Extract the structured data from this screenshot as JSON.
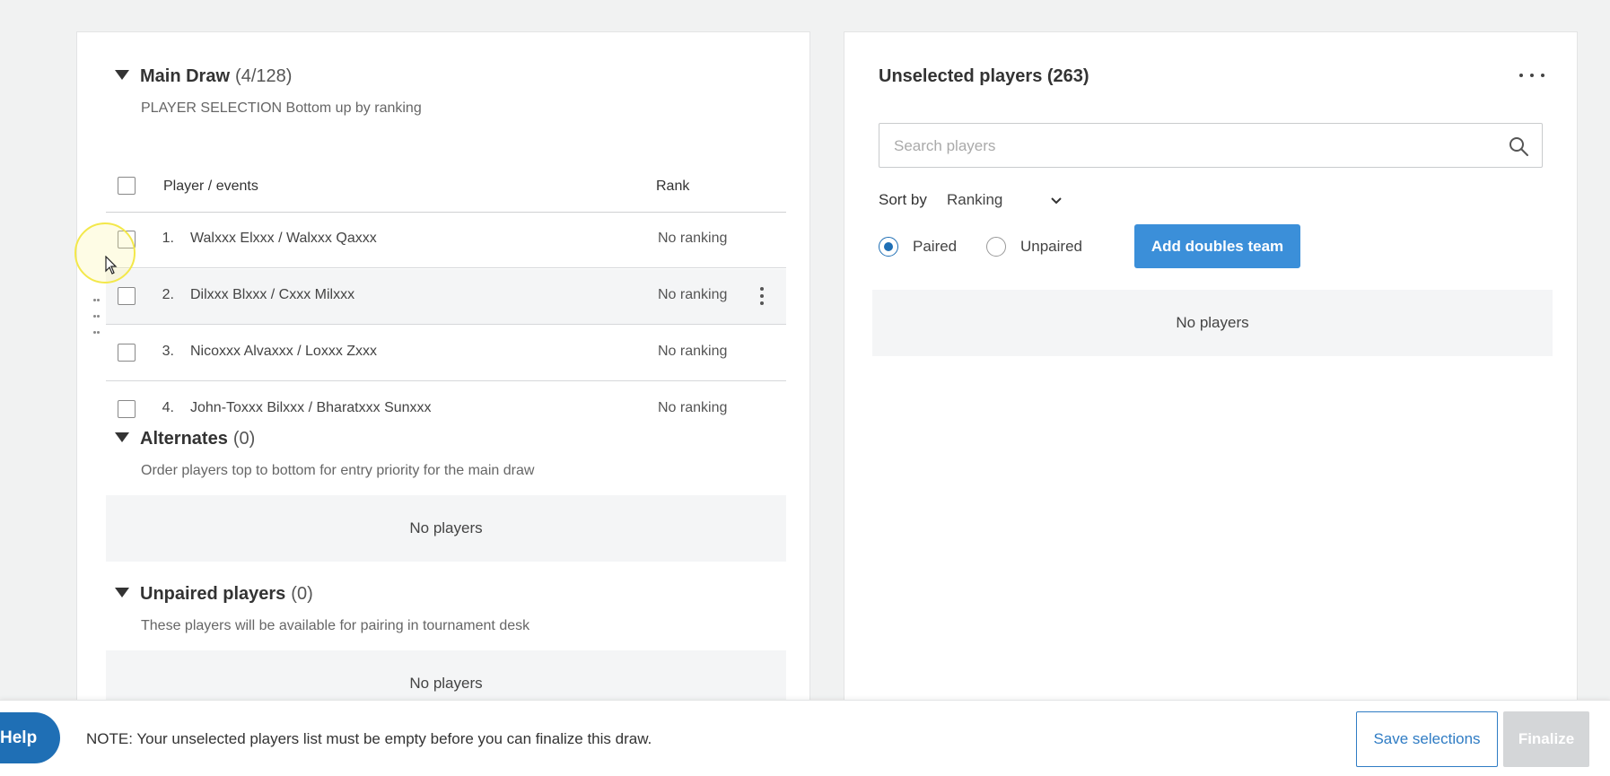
{
  "main_draw": {
    "title": "Main Draw",
    "count": "(4/128)",
    "subtitle": "PLAYER SELECTION Bottom up by ranking",
    "columns": {
      "player": "Player / events",
      "rank": "Rank"
    },
    "rows": [
      {
        "num": "1.",
        "name": "Walxxx Elxxx / Walxxx Qaxxx",
        "rank": "No ranking"
      },
      {
        "num": "2.",
        "name": "Dilxxx Blxxx / Cxxx Milxxx",
        "rank": "No ranking"
      },
      {
        "num": "3.",
        "name": "Nicoxxx Alvaxxx / Loxxx Zxxx",
        "rank": "No ranking"
      },
      {
        "num": "4.",
        "name": "John-Toxxx Bilxxx / Bharatxxx Sunxxx",
        "rank": "No ranking"
      }
    ]
  },
  "alternates": {
    "title": "Alternates",
    "count": "(0)",
    "subtitle": "Order players top to bottom for entry priority for the main draw",
    "empty": "No players"
  },
  "unpaired": {
    "title": "Unpaired players",
    "count": "(0)",
    "subtitle": "These players will be available for pairing in tournament desk",
    "empty": "No players"
  },
  "unselected": {
    "title": "Unselected players (263)",
    "search_placeholder": "Search players",
    "sort_label": "Sort by",
    "sort_value": "Ranking",
    "radio_paired": "Paired",
    "radio_unpaired": "Unpaired",
    "add_button": "Add doubles team",
    "empty": "No players"
  },
  "footer": {
    "help": "Help",
    "note": "NOTE: Your unselected players list must be empty before you can finalize this draw.",
    "save": "Save selections",
    "finalize": "Finalize"
  },
  "colors": {
    "primary": "#3b8fd9",
    "help": "#1f6fb5",
    "disabled": "#d4d6d8"
  },
  "icons": [
    "caret-down-icon",
    "search-icon",
    "chevron-down-icon",
    "more-horizontal-icon",
    "kebab-icon",
    "drag-handle-icon"
  ]
}
